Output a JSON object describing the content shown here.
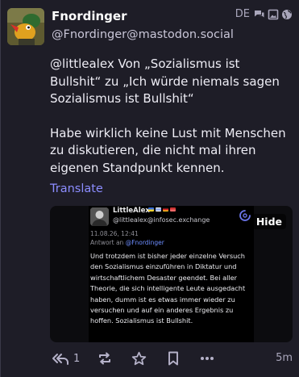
{
  "post": {
    "display_name": "Fnordinger",
    "account": "@Fnordinger@mastodon.social",
    "language": "DE",
    "icons": [
      "thread-icon",
      "image-icon",
      "globe-icon"
    ],
    "content": {
      "mention": "@littlealex",
      "line1_rest": " Von „Sozialismus ist Bullshit“ zu „Ich würde niemals sagen Sozialismus ist Bullshit“",
      "paragraph2": "Habe wirklich keine Lust mit Menschen zu diskutieren, die nicht mal ihren eigenen Standpunkt kennen."
    },
    "translate_label": "Translate",
    "media": {
      "hide_label": "Hide",
      "screenshot": {
        "name": "LittleAlex",
        "account": "@littlealex@infosec.exchange",
        "timestamp": "11.08.26, 12:41",
        "reply_prefix": "Antwort an ",
        "reply_target": "@Fnordinger",
        "body": "Und trotzdem ist bisher jeder einzelne Versuch den Sozialismus einzuführen in Diktatur und wirtschaftlichem Desaster geendet. Bei aller Theorie, die sich intelligente Leute ausgedacht haben, dumm ist es etwas immer wieder zu versuchen und auf ein anderes Ergebnis zu hoffen. Sozialismus ist Bullshit."
      }
    },
    "actions": {
      "reply_count": "1",
      "relative_time": "5m"
    },
    "colors": {
      "background": "#1e1d27",
      "link": "#8c8dff",
      "muted": "#b5b2c9"
    }
  }
}
